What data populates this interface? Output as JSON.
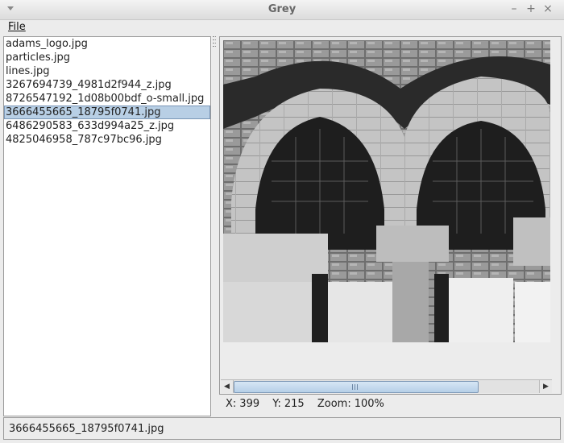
{
  "window": {
    "title": "Grey"
  },
  "menubar": {
    "file": "File"
  },
  "files": [
    "adams_logo.jpg",
    "particles.jpg",
    "lines.jpg",
    "3267694739_4981d2f944_z.jpg",
    "8726547192_1d08b00bdf_o-small.jpg",
    "3666455665_18795f0741.jpg",
    "6486290583_633d994a25_z.jpg",
    "4825046958_787c97bc96.jpg"
  ],
  "selected_file_index": 5,
  "image": {
    "description_icon": "image-preview"
  },
  "scrollbar": {
    "left_icon": "arrow-left-icon",
    "right_icon": "arrow-right-icon"
  },
  "status": {
    "x_label": "X:",
    "x_value": "399",
    "y_label": "Y:",
    "y_value": "215",
    "zoom_label": "Zoom:",
    "zoom_value": "100%"
  },
  "bottom_status": {
    "text": "3666455665_18795f0741.jpg"
  },
  "colors": {
    "selection": "#b8cfe5",
    "thumb": "#b6cfe7"
  }
}
